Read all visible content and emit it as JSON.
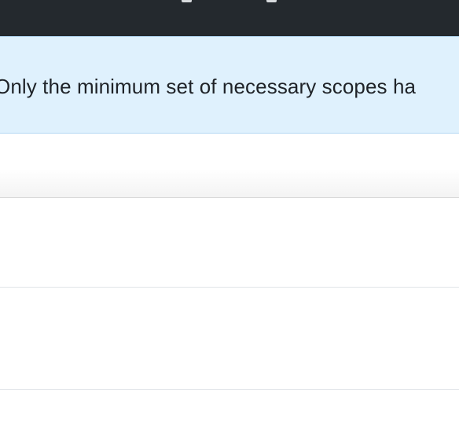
{
  "banner": {
    "message": "Only the minimum set of necessary scopes ha"
  },
  "colors": {
    "header_bg": "#24292e",
    "banner_bg": "#dff1fd",
    "banner_border": "#b4d8f3",
    "text": "#1f2328",
    "divider": "#e1e4e8"
  }
}
